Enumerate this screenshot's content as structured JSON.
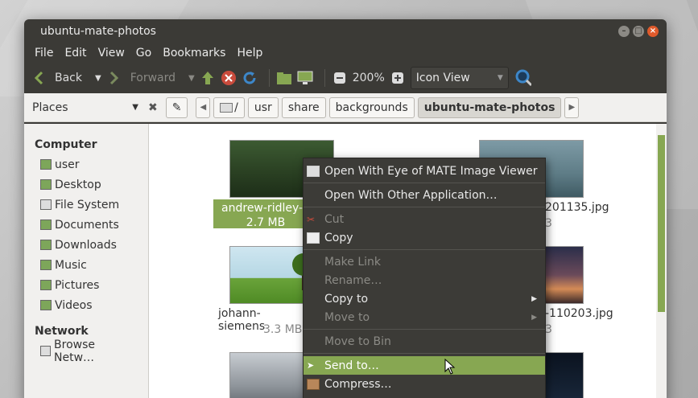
{
  "window": {
    "title": "ubuntu-mate-photos"
  },
  "menubar": [
    "File",
    "Edit",
    "View",
    "Go",
    "Bookmarks",
    "Help"
  ],
  "toolbar": {
    "back": "Back",
    "forward": "Forward",
    "zoom": "200%",
    "view_mode": "Icon View"
  },
  "location": {
    "places": "Places",
    "crumbs": [
      "/",
      "usr",
      "share",
      "backgrounds",
      "ubuntu-mate-photos"
    ]
  },
  "sidebar": {
    "computer_head": "Computer",
    "computer_items": [
      "user",
      "Desktop",
      "File System",
      "Documents",
      "Downloads",
      "Music",
      "Pictures",
      "Videos"
    ],
    "network_head": "Network",
    "network_items": [
      "Browse Netw…"
    ]
  },
  "files": [
    {
      "name": "andrew-ridley-5",
      "size": "2.7 MB",
      "selected": true
    },
    {
      "name": "201135.jpg",
      "size": "3"
    },
    {
      "name": "johann-siemens",
      "size": "3.3 MB"
    },
    {
      "name": "-110203.jpg",
      "size": "3"
    }
  ],
  "context_menu": {
    "items": [
      "Open With Eye of MATE Image Viewer",
      "Open With Other Application…",
      "Cut",
      "Copy",
      "Make Link",
      "Rename…",
      "Copy to",
      "Move to",
      "Move to Bin",
      "Send to…",
      "Compress…"
    ]
  },
  "colors": {
    "accent": "#87a752",
    "window_bg": "#3b3a36",
    "menu_bg": "#3c3b37"
  }
}
